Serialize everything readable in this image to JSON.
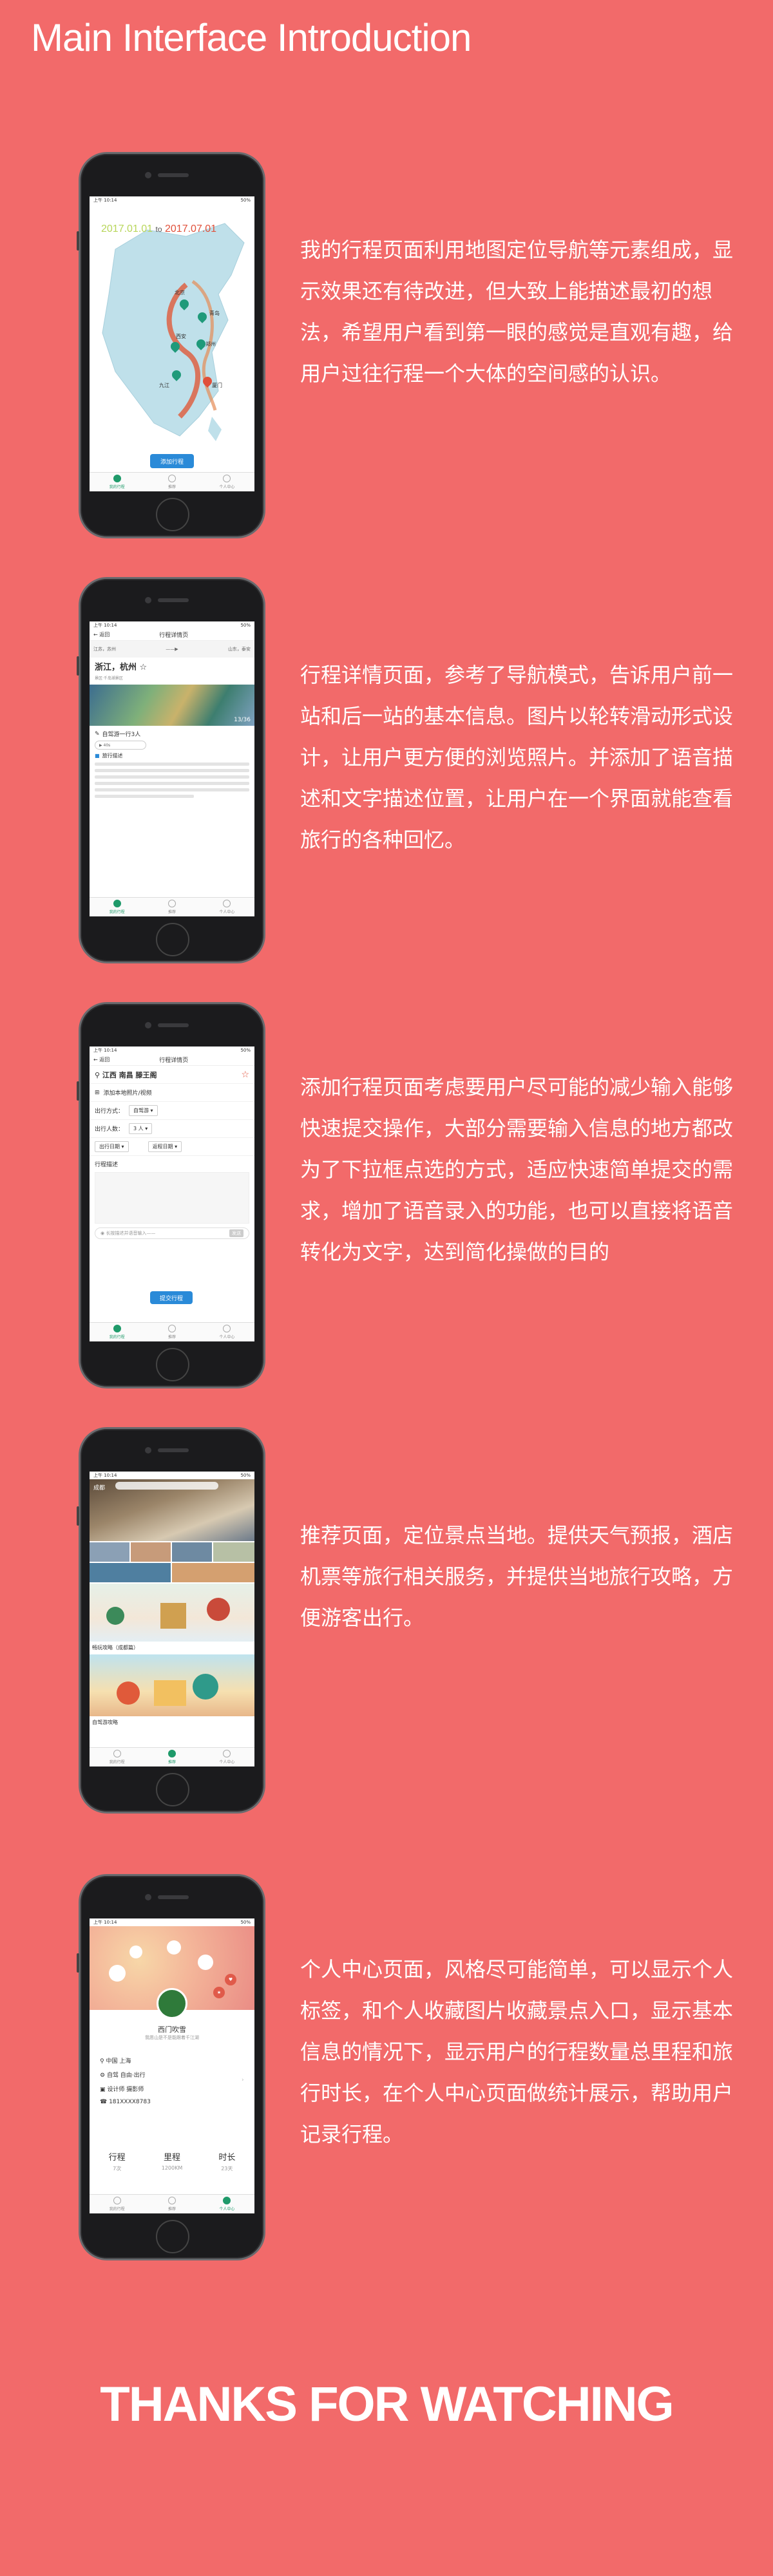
{
  "page_title": "Main Interface Introduction",
  "thanks": "THANKS FOR WATCHING",
  "tabs": [
    "我的行程",
    "推荐",
    "个人中心"
  ],
  "status": {
    "time": "上午 10:14",
    "battery": "50%"
  },
  "section1": {
    "desc": "我的行程页面利用地图定位导航等元素组成，显示效果还有待改进，但大致上能描述最初的想法，希望用户看到第一眼的感觉是直观有趣，给用户过往行程一个大体的空间感的认识。",
    "start_date": "2017.01.01",
    "to": "to",
    "end_date": "2017.07.01",
    "cities": [
      "北京",
      "青岛",
      "西安",
      "郑州",
      "九江",
      "厦门"
    ],
    "add_button": "添加行程"
  },
  "section2": {
    "desc": "行程详情页面，参考了导航模式，告诉用户前一站和后一站的基本信息。图片以轮转滑动形式设计，让用户更方便的浏览照片。并添加了语音描述和文字描述位置，让用户在一个界面就能查看旅行的各种回忆。",
    "nav_back": "返回",
    "nav_title": "行程详情页",
    "route_from": "江苏，苏州",
    "route_to": "山东，泰安",
    "place": "浙江，杭州",
    "place_sub": "景区·千岛湖景区",
    "photo_count": "13/36",
    "companion": "自驾游一行3人",
    "voice": "40s",
    "note_label": "旅行描述"
  },
  "section3": {
    "desc": "添加行程页面考虑要用户尽可能的减少输入能够快速提交操作，大部分需要输入信息的地方都改为了下拉框点选的方式，适应快速简单提交的需求，增加了语音录入的功能，也可以直接将语音转化为文字，达到简化操做的目的",
    "nav_back": "返回",
    "nav_title": "行程详情页",
    "location": "江西 南昌 滕王阁",
    "add_photo": "添加本地照片/视频",
    "mode_label": "出行方式：",
    "mode_value": "自驾游",
    "people_label": "出行人数：",
    "people_value": "3 人",
    "date_label": "出行日期",
    "return_label": "返程日期",
    "note_label": "行程描述",
    "input_placeholder": "长按描述并语音输入——",
    "send": "发送",
    "submit": "提交行程"
  },
  "section4": {
    "desc": "推荐页面，定位景点当地。提供天气预报，酒店机票等旅行相关服务，并提供当地旅行攻略，方便游客出行。",
    "city": "成都",
    "caption1": "畅玩攻略（成都篇）",
    "caption2": "自驾游攻略"
  },
  "section5": {
    "desc": "个人中心页面，风格尽可能简单，可以显示个人标签，和个人收藏图片收藏景点入口，显示基本信息的情况下，显示用户的行程数量总里程和旅行时长，在个人中心页面做统计展示，帮助用户记录行程。",
    "name": "西门吹雪",
    "signature": "我愿山是不是能跟着千江湖",
    "location": "中国 上海",
    "tags": "自驾 自由·出行",
    "job": "设计师  摄影师",
    "phone": "181XXXX8783",
    "stats": [
      {
        "label": "行程",
        "value": "7次"
      },
      {
        "label": "里程",
        "value": "1200KM"
      },
      {
        "label": "时长",
        "value": "23天"
      }
    ]
  }
}
